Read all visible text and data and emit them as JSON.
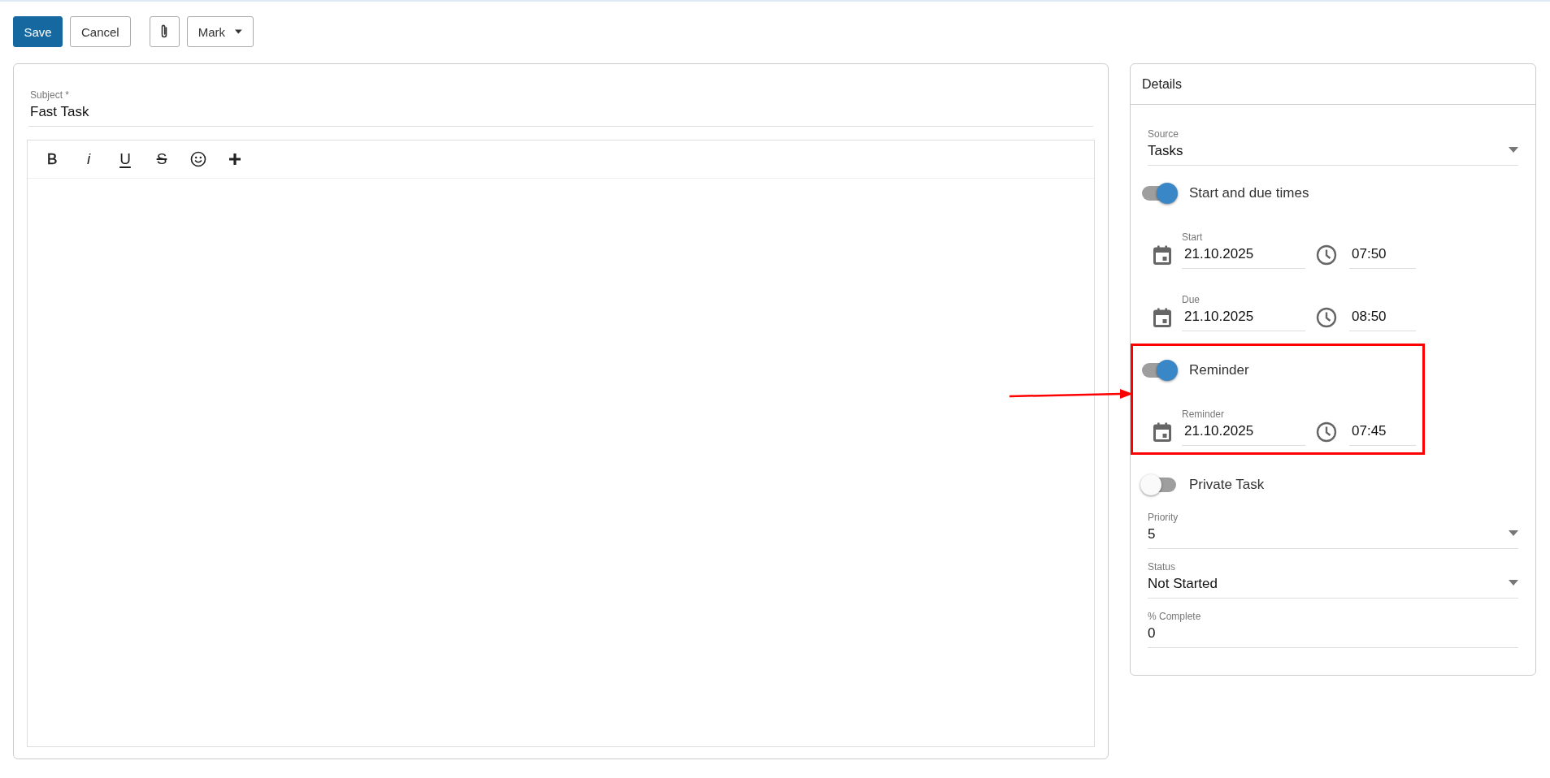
{
  "toolbar": [
    {
      "kind": "primary",
      "label": "Save"
    },
    {
      "kind": "default",
      "label": "Cancel"
    },
    {
      "kind": "attach"
    },
    {
      "kind": "dropdown",
      "label": "Mark"
    }
  ],
  "subject": {
    "label": "Subject *",
    "value": "Fast Task"
  },
  "editor": {
    "tools": [
      {
        "kind": "bold",
        "glyph": "B"
      },
      {
        "kind": "italic",
        "glyph": "i"
      },
      {
        "kind": "underline",
        "glyph": "U"
      },
      {
        "kind": "strike",
        "glyph": "S"
      },
      {
        "kind": "emoji"
      },
      {
        "kind": "insert"
      }
    ]
  },
  "details": {
    "title": "Details",
    "items": [
      {
        "kind": "select",
        "label": "Source",
        "value": "Tasks"
      },
      {
        "kind": "toggle",
        "label": "Start and due times",
        "on": true
      },
      {
        "kind": "datetime",
        "label": "Start",
        "date": "21.10.2025",
        "time": "07:50"
      },
      {
        "kind": "datetime",
        "label": "Due",
        "date": "21.10.2025",
        "time": "08:50"
      },
      {
        "kind": "group",
        "highlighted": true,
        "children": [
          {
            "kind": "toggle",
            "label": "Reminder",
            "on": true
          },
          {
            "kind": "datetime",
            "label": "Reminder",
            "date": "21.10.2025",
            "time": "07:45"
          }
        ]
      },
      {
        "kind": "toggle",
        "label": "Private Task",
        "on": false
      },
      {
        "kind": "select",
        "label": "Priority",
        "value": "5"
      },
      {
        "kind": "select",
        "label": "Status",
        "value": "Not Started"
      },
      {
        "kind": "text",
        "label": "% Complete",
        "value": "0"
      }
    ]
  }
}
